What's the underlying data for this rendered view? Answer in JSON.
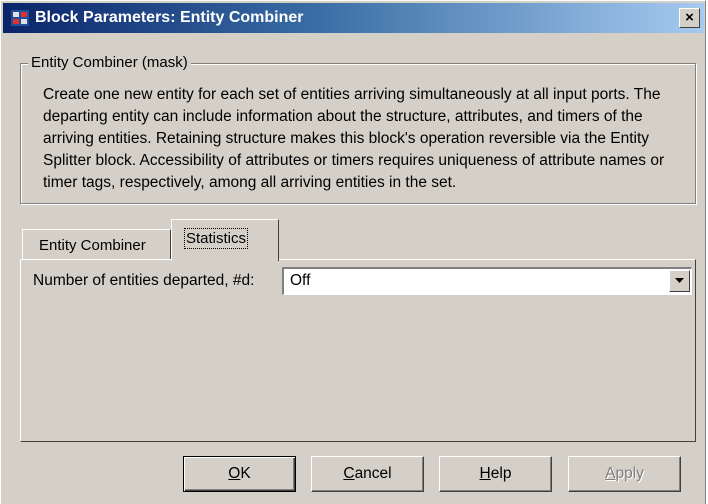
{
  "window": {
    "title": "Block Parameters: Entity Combiner",
    "icon": "simulink-block-icon",
    "close_label": "×"
  },
  "group": {
    "legend": "Entity Combiner (mask)",
    "description": "Create one new entity for each set of entities arriving simultaneously at all input ports. The departing entity can include information about the structure, attributes, and timers of the arriving entities. Retaining structure makes this block's operation reversible via the Entity Splitter block. Accessibility of attributes or timers requires uniqueness of attribute names or timer tags, respectively, among all arriving entities in the set."
  },
  "tabs": [
    {
      "label": "Entity Combiner",
      "active": false
    },
    {
      "label": "Statistics",
      "active": true
    }
  ],
  "statistics": {
    "departed_label": "Number of entities departed, #d:",
    "departed_value": "Off"
  },
  "buttons": {
    "ok": {
      "accel": "O",
      "rest": "K"
    },
    "cancel": {
      "accel": "C",
      "rest": "ancel"
    },
    "help": {
      "accel": "H",
      "rest": "elp"
    },
    "apply": {
      "accel": "A",
      "rest": "pply",
      "enabled": false
    }
  },
  "colors": {
    "dialog_bg": "#d4d0c8",
    "title_start": "#0a246a",
    "title_end": "#a6caf0",
    "disabled_text": "#808080"
  }
}
